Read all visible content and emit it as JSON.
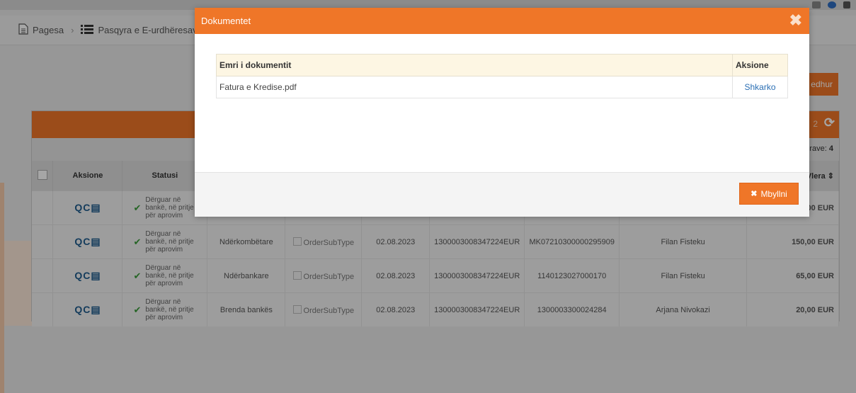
{
  "breadcrumb": {
    "item1": "Pagesa",
    "item2": "Pasqyra e E-urdhëresav"
  },
  "toolbar": {
    "new_button_label": "edhur"
  },
  "panel": {
    "count_text": "2",
    "total_label": "rave:",
    "total_value": "4"
  },
  "table": {
    "headers": {
      "actions": "Aksione",
      "status": "Statusi",
      "amount": "Vlera ⇕"
    },
    "rows": [
      {
        "status": "Dërguar në bankë, në pritje për aprovim",
        "type": "",
        "subtype": "",
        "date": "",
        "debit": "",
        "credit": "",
        "beneficiary": "",
        "amount": "00 EUR"
      },
      {
        "status": "Dërguar në bankë, në pritje për aprovim",
        "type": "Ndërkombëtare",
        "subtype": "OrderSubType",
        "date": "02.08.2023",
        "debit": "1300003008347224EUR",
        "credit": "MK07210300000295909",
        "beneficiary": "Filan Fisteku",
        "amount": "150,00 EUR"
      },
      {
        "status": "Dërguar në bankë, në pritje për aprovim",
        "type": "Ndërbankare",
        "subtype": "OrderSubType",
        "date": "02.08.2023",
        "debit": "1300003008347224EUR",
        "credit": "1140123027000170",
        "beneficiary": "Filan Fisteku",
        "amount": "65,00 EUR"
      },
      {
        "status": "Dërguar në bankë, në pritje për aprovim",
        "type": "Brenda bankës",
        "subtype": "OrderSubType",
        "date": "02.08.2023",
        "debit": "1300003008347224EUR",
        "credit": "1300003300024284",
        "beneficiary": "Arjana Nivokazi",
        "amount": "20,00 EUR"
      }
    ]
  },
  "modal": {
    "title": "Dokumentet",
    "col_name": "Emri i dokumentit",
    "col_actions": "Aksione",
    "documents": [
      {
        "name": "Fatura e Kredise.pdf",
        "action": "Shkarko"
      }
    ],
    "close_label": "Mbyllni"
  },
  "colors": {
    "accent": "#ef7628",
    "link": "#2b6fb4"
  }
}
